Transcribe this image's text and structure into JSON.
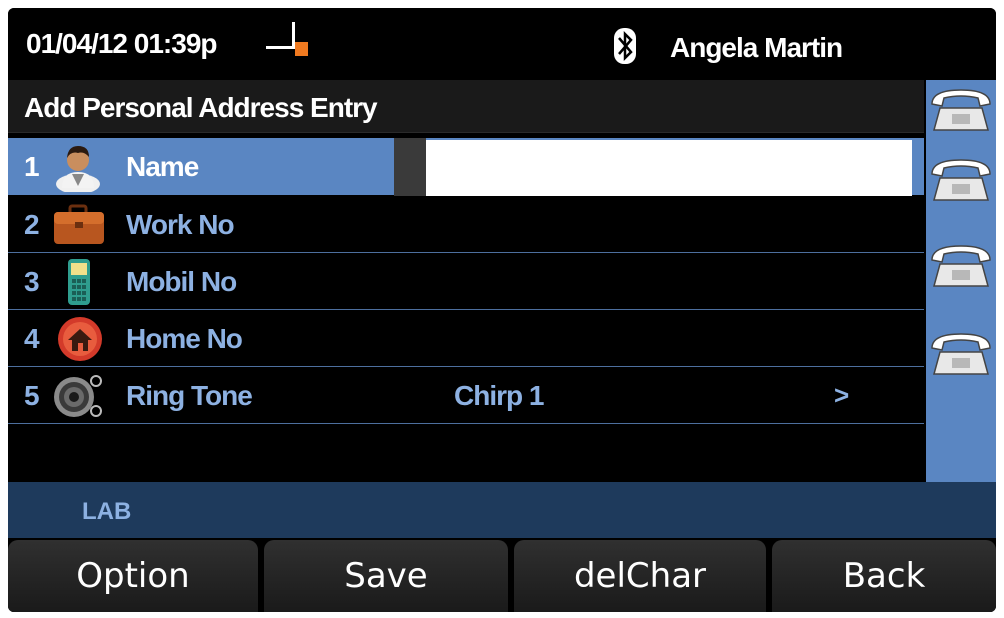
{
  "status": {
    "datetime": "01/04/12 01:39p",
    "signal_icon": "line-status-icon",
    "bluetooth_icon": "bluetooth-icon",
    "user_name": "Angela Martin"
  },
  "screen_title": "Add Personal Address Entry",
  "fields": [
    {
      "number": "1",
      "icon": "person-icon",
      "label": "Name",
      "value": ""
    },
    {
      "number": "2",
      "icon": "briefcase-icon",
      "label": "Work No",
      "value": ""
    },
    {
      "number": "3",
      "icon": "mobile-phone-icon",
      "label": "Mobil No",
      "value": ""
    },
    {
      "number": "4",
      "icon": "home-icon",
      "label": "Home No",
      "value": ""
    },
    {
      "number": "5",
      "icon": "speaker-icon",
      "label": "Ring Tone",
      "value": "Chirp 1",
      "arrow": ">"
    }
  ],
  "line_keys": [
    "phone-line-icon",
    "phone-line-icon",
    "phone-line-icon",
    "phone-line-icon"
  ],
  "status_label": "LAB",
  "softkeys": [
    "Option",
    "Save",
    "delChar",
    "Back"
  ],
  "colors": {
    "highlight": "#5a86c2",
    "label_text": "#8db1e2",
    "lab_bar": "#1e3a5c",
    "signal_accent": "#f07a20"
  }
}
